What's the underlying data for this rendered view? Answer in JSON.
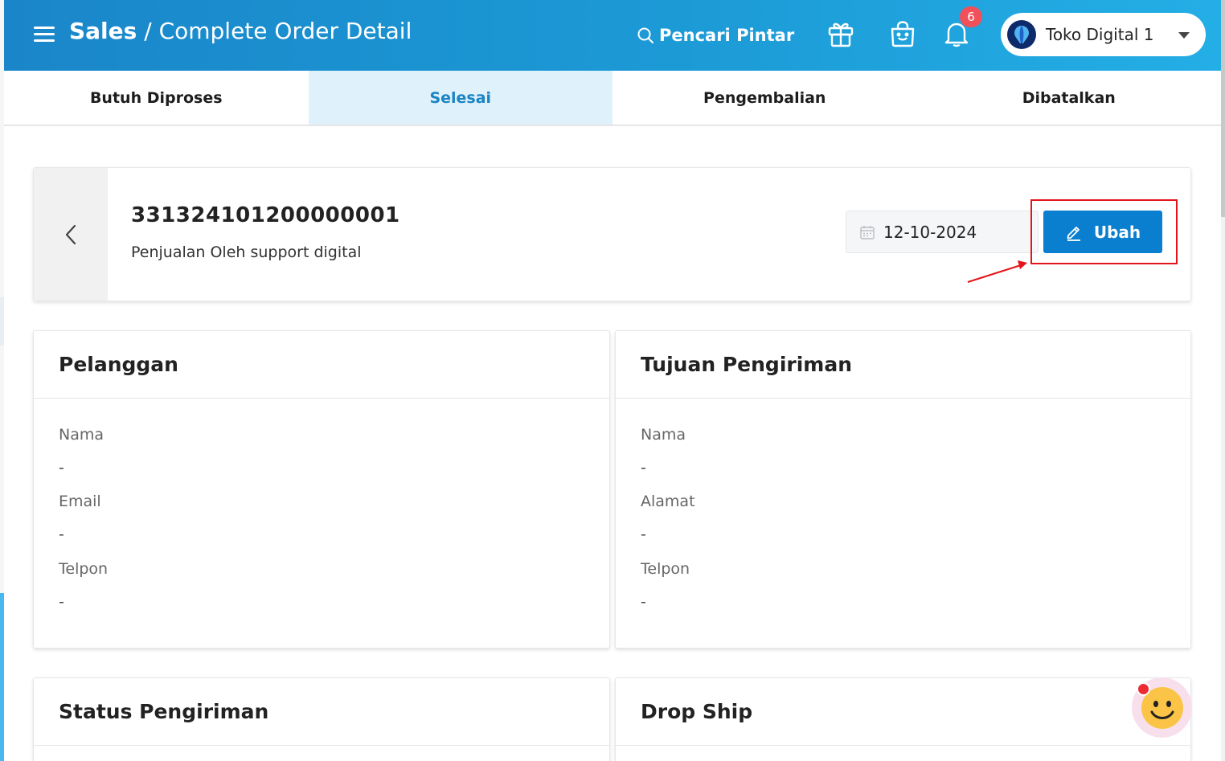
{
  "header": {
    "title_bold": "Sales",
    "title_rest": " / Complete Order Detail",
    "smart_search": "Pencari Pintar",
    "notification_count": "6",
    "store_name": "Toko Digital 1",
    "icons": [
      "menu-icon",
      "search-icon",
      "gift-icon",
      "shopping-bag-icon",
      "bell-icon",
      "chevron-down-icon"
    ],
    "colors": {
      "bar_start": "#1a86c9",
      "bar_end": "#24aee6",
      "badge": "#f0505a"
    }
  },
  "tabs": [
    {
      "label": "Butuh Diproses",
      "active": false
    },
    {
      "label": "Selesai",
      "active": true
    },
    {
      "label": "Pengembalian",
      "active": false
    },
    {
      "label": "Dibatalkan",
      "active": false
    }
  ],
  "order": {
    "number": "331324101200000001",
    "subtitle": "Penjualan Oleh support digital",
    "date": "12-10-2024",
    "edit_label": "Ubah",
    "accent": "#0a7fd0"
  },
  "customer": {
    "heading": "Pelanggan",
    "fields": [
      {
        "label": "Nama",
        "value": "-"
      },
      {
        "label": "Email",
        "value": "-"
      },
      {
        "label": "Telpon",
        "value": "-"
      }
    ]
  },
  "shipping": {
    "heading": "Tujuan Pengiriman",
    "fields": [
      {
        "label": "Nama",
        "value": "-"
      },
      {
        "label": "Alamat",
        "value": "-"
      },
      {
        "label": "Telpon",
        "value": "-"
      }
    ]
  },
  "shipping_status": {
    "heading": "Status Pengiriman"
  },
  "drop_ship": {
    "heading": "Drop Ship"
  }
}
